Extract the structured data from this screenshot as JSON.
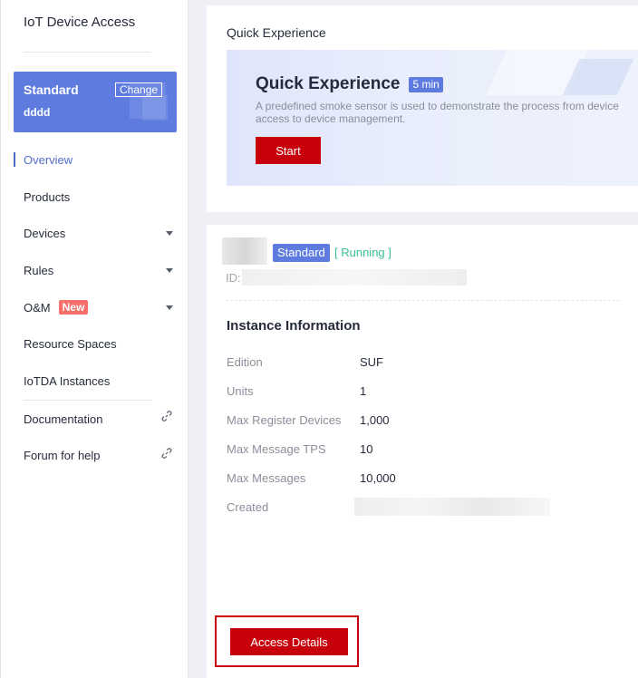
{
  "sidebar": {
    "title": "IoT Device Access",
    "edition_card": {
      "name": "Standard",
      "instance_name": "dddd",
      "change_label": "Change"
    },
    "nav": {
      "overview": "Overview",
      "products": "Products",
      "devices": "Devices",
      "rules": "Rules",
      "om": "O&M",
      "om_badge": "New",
      "resource_spaces": "Resource Spaces",
      "iotda_instances": "IoTDA Instances",
      "documentation": "Documentation",
      "forum": "Forum for help"
    }
  },
  "quick_experience": {
    "panel_title": "Quick Experience",
    "heading": "Quick Experience",
    "time_badge": "5 min",
    "description": "A predefined smoke sensor is used to demonstrate the process from device\naccess to device management.",
    "start_label": "Start"
  },
  "instance": {
    "edition_badge": "Standard",
    "status": "[ Running ]",
    "id_label": "ID:",
    "info_heading": "Instance Information",
    "info": {
      "edition_label": "Edition",
      "edition_value": "SUF",
      "units_label": "Units",
      "units_value": "1",
      "max_register_label": "Max Register Devices",
      "max_register_value": "1,000",
      "max_tps_label": "Max Message TPS",
      "max_tps_value": "10",
      "max_messages_label": "Max Messages",
      "max_messages_value": "10,000",
      "created_label": "Created"
    },
    "access_details_label": "Access Details"
  },
  "colors": {
    "brand_red": "#c7000b",
    "accent_blue": "#5e7ce0",
    "running_green": "#3ac295",
    "new_badge": "#f66f6a"
  }
}
